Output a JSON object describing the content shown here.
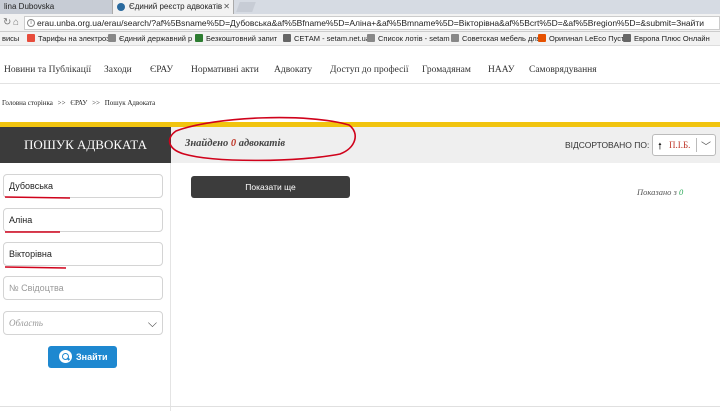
{
  "browser": {
    "tabs": [
      {
        "label": "lina Dubovska",
        "active": false
      },
      {
        "label": "Єдиний реєстр адвокатів",
        "active": true
      }
    ],
    "url": "erau.unba.org.ua/erau/search/?af%5Bsname%5D=Дубовська&af%5Bfname%5D=Аліна+&af%5Bmname%5D=Вікторівна&af%5Bcrt%5D=&af%5Bregion%5D=&submit=Знайти",
    "bookmarks": [
      {
        "label": "висы",
        "color": ""
      },
      {
        "label": "Тарифы на электроэн",
        "color": "#e74c3c"
      },
      {
        "label": "Єдиний державний р",
        "color": "#888888"
      },
      {
        "label": "Безкоштовний запит",
        "color": "#2e7d32"
      },
      {
        "label": "СЕТАМ - setam.net.ua",
        "color": "#666666"
      },
      {
        "label": "Список лотів - setam",
        "color": "#888888"
      },
      {
        "label": "Советская мебель для",
        "color": "#888888"
      },
      {
        "label": "Оригинал LeEco Пуст",
        "color": "#e65100"
      },
      {
        "label": "Европа Плюс Онлайн",
        "color": "#666666"
      }
    ]
  },
  "site": {
    "nav": [
      "Новини та Публікації",
      "Заходи",
      "ЄРАУ",
      "Нормативні акти",
      "Адвокату",
      "Доступ до професії",
      "Громадянам",
      "НААУ",
      "Самоврядування"
    ],
    "breadcrumb": [
      "Головна сторінка",
      ">>",
      "ЄРАУ",
      ">>",
      "Пошук Адвоката"
    ]
  },
  "search": {
    "title": "ПОШУК АДВОКАТА",
    "surname": "Дубовська",
    "name": "Аліна",
    "patronymic": "Вікторівна",
    "certificate_placeholder": "№ Свідоцтва",
    "region_placeholder": "Область",
    "submit_label": "Знайти"
  },
  "results": {
    "found_prefix": "Знайдено",
    "found_count": "0",
    "found_suffix": "адвокатів",
    "sort_label": "ВІДСОРТОВАНО ПО:",
    "sort_value": "П.І.Б.",
    "show_button": "Показати ще",
    "shown_prefix": "Показано з",
    "shown_count": "0"
  },
  "colors": {
    "accent_yellow": "#f1c40f",
    "header_dark": "#3b3b3b",
    "button_blue": "#1e88d0",
    "annotation_red": "#d0021b",
    "count_red": "#c0392b",
    "shown_green": "#2eab5b"
  }
}
